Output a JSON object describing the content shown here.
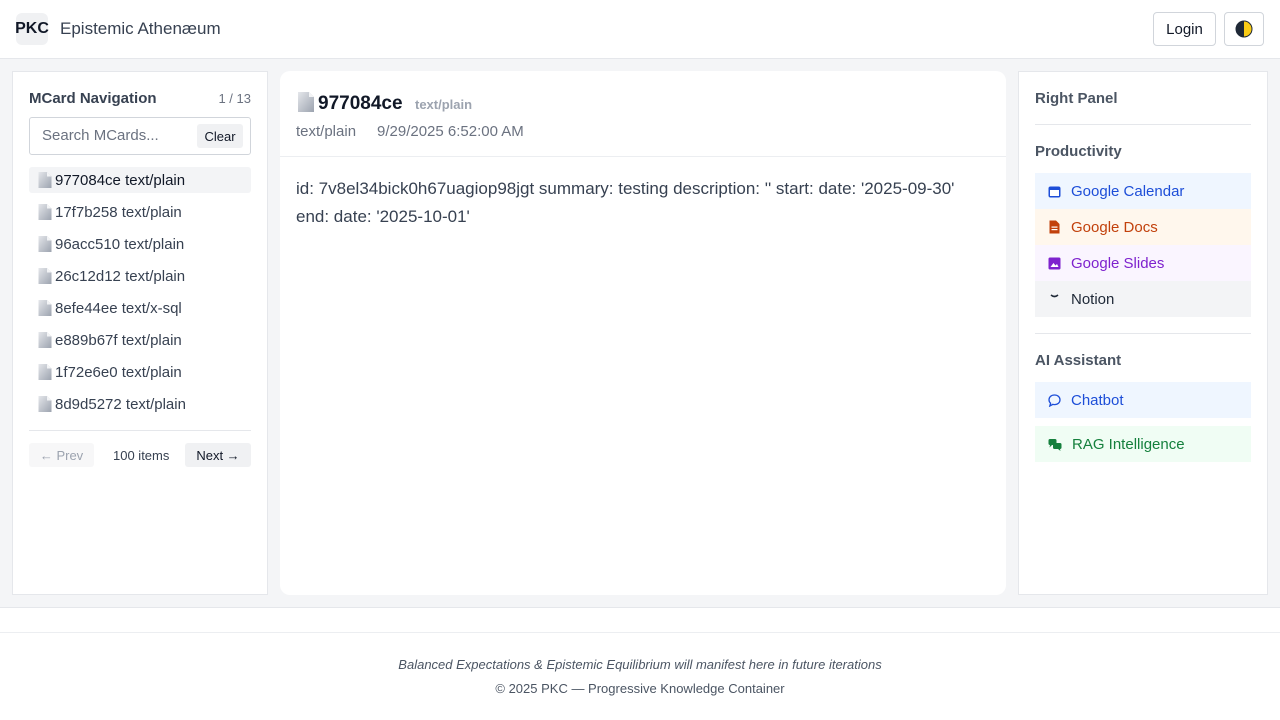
{
  "header": {
    "logo": "PKC",
    "title": "Epistemic Athenæum",
    "login_label": "Login",
    "theme_icon": "half-moon-icon"
  },
  "nav": {
    "title": "MCard Navigation",
    "page_indicator": "1 / 13",
    "search_placeholder": "Search MCards...",
    "clear_label": "Clear",
    "items": [
      {
        "label": "977084ce text/plain",
        "selected": true
      },
      {
        "label": "17f7b258 text/plain"
      },
      {
        "label": "96acc510 text/plain"
      },
      {
        "label": "26c12d12 text/plain"
      },
      {
        "label": "8efe44ee text/x-sql"
      },
      {
        "label": "e889b67f text/plain"
      },
      {
        "label": "1f72e6e0 text/plain"
      },
      {
        "label": "8d9d5272 text/plain"
      }
    ],
    "prev_label": "← Prev",
    "items_count": "100 items",
    "next_label": "Next →"
  },
  "card": {
    "hash": "977084ce",
    "type_badge": "text/plain",
    "meta_type": "text/plain",
    "meta_date": "9/29/2025 6:52:00 AM",
    "content": "id: 7v8el34bick0h67uagiop98jgt summary: testing description: '' start: date: '2025-09-30' end: date: '2025-10-01'"
  },
  "right_panel": {
    "title": "Right Panel",
    "productivity_title": "Productivity",
    "productivity": [
      {
        "label": "Google Calendar",
        "icon": "calendar-icon",
        "color": "#1d4ed8",
        "bg": "#eff6ff"
      },
      {
        "label": "Google Docs",
        "icon": "document-icon",
        "color": "#c2410c",
        "bg": "#fff7ed"
      },
      {
        "label": "Google Slides",
        "icon": "slides-icon",
        "color": "#7e22ce",
        "bg": "#faf5ff"
      },
      {
        "label": "Notion",
        "icon": "notion-icon",
        "color": "#1f2937",
        "bg": "#f3f4f6"
      }
    ],
    "ai_title": "AI Assistant",
    "ai": [
      {
        "label": "Chatbot",
        "icon": "chat-bubble-icon",
        "color": "#1d4ed8",
        "bg": "#eff6ff"
      },
      {
        "label": "RAG Intelligence",
        "icon": "chat-bubbles-icon",
        "color": "#15803d",
        "bg": "#f0fdf4"
      }
    ]
  },
  "footer": {
    "quote": "Balanced Expectations & Epistemic Equilibrium will manifest here in future iterations",
    "copyright": "© 2025 PKC — Progressive Knowledge Container"
  }
}
